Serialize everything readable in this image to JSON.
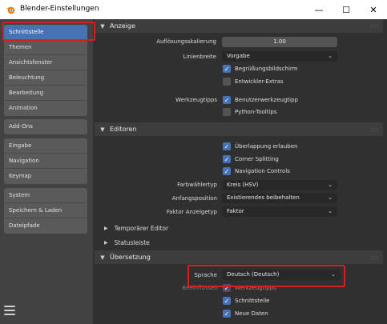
{
  "window": {
    "title": "Blender-Einstellungen",
    "min": "—",
    "max": "☐",
    "close": "✕"
  },
  "sidebar": {
    "group1": [
      "Schnittstelle",
      "Themen",
      "Ansichtsfenster",
      "Beleuchtung",
      "Bearbeitung",
      "Animation"
    ],
    "group2": [
      "Add-Ons"
    ],
    "group3": [
      "Eingabe",
      "Navigation",
      "Keymap"
    ],
    "group4": [
      "System",
      "Speichern & Laden",
      "Dateipfade"
    ]
  },
  "anzeige": {
    "title": "Anzeige",
    "scale_label": "Auflösungsskalierung",
    "scale_value": "1.00",
    "line_label": "Linienbreite",
    "line_value": "Vorgabe",
    "splash": "Begrüßungsbildschirm",
    "devextras": "Entwickler-Extras",
    "tooltips_label": "Werkzeugtipps",
    "user_tooltips": "Benutzerwerkzeugtipp",
    "python_tooltips": "Python-Tooltips"
  },
  "editoren": {
    "title": "Editoren",
    "overlap": "Überlappung erlauben",
    "corner": "Corner Splitting",
    "navctrl": "Navigation Controls",
    "color_label": "Farbwählertyp",
    "color_value": "Kreis (HSV)",
    "start_label": "Anfangsposition",
    "start_value": "Existierendes beibehalten",
    "factor_label": "Faktor Anzeigetyp",
    "factor_value": "Faktor",
    "temp_editor": "Temporärer Editor",
    "statusbar": "Statusleiste"
  },
  "uebersetzung": {
    "title": "Übersetzung",
    "lang_label": "Sprache",
    "lang_value": "Deutsch (Deutsch)",
    "affect_label": "Beeinflussen",
    "tooltips": "Werkzeugtipps",
    "interface": "Schnittstelle",
    "newdata": "Neue Daten"
  },
  "colors": {
    "accent": "#4772b3",
    "highlight": "#d62020"
  }
}
